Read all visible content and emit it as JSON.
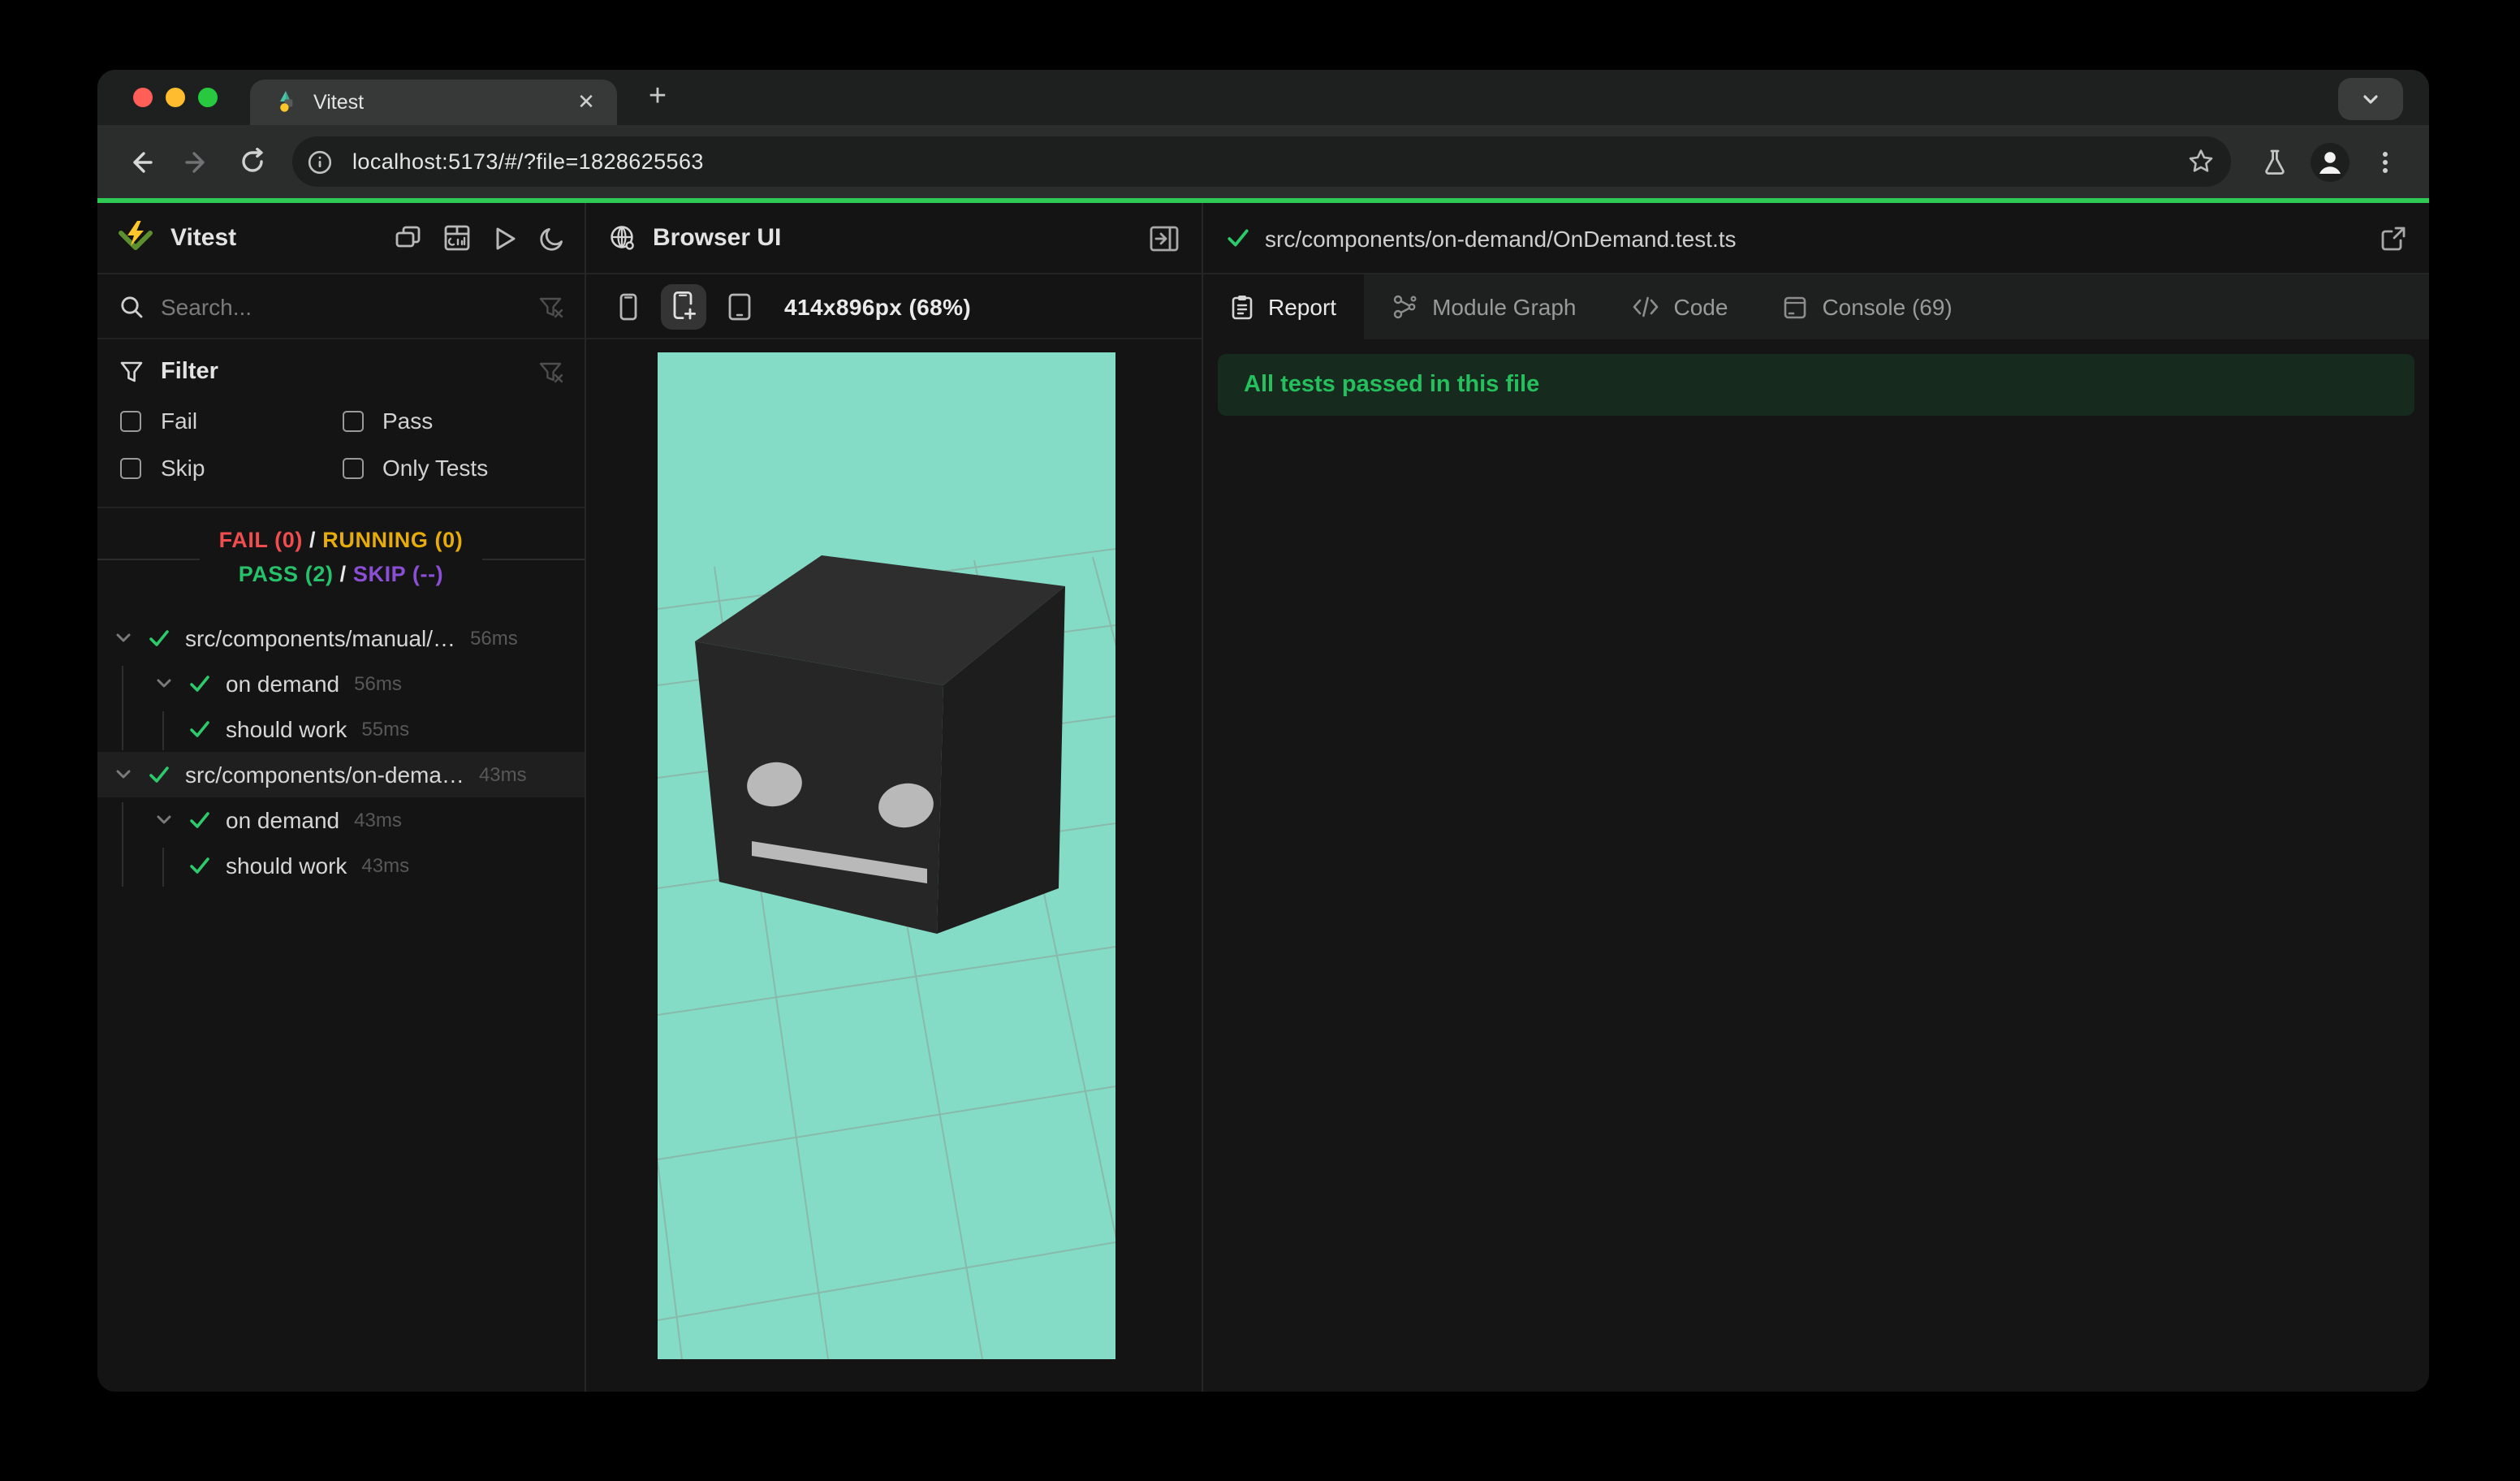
{
  "browser": {
    "tab_title": "Vitest",
    "url": "localhost:5173/#/?file=1828625563",
    "close_glyph": "✕",
    "newtab_glyph": "+"
  },
  "sidebar": {
    "app_title": "Vitest",
    "search_placeholder": "Search...",
    "filter": {
      "title": "Filter",
      "items": [
        {
          "label": "Fail"
        },
        {
          "label": "Pass"
        },
        {
          "label": "Skip"
        },
        {
          "label": "Only Tests"
        }
      ]
    },
    "summary": {
      "fail": "FAIL (0)",
      "sep1": " / ",
      "running": "RUNNING (0)",
      "pass": "PASS (2)",
      "sep2": " / ",
      "skip": "SKIP (--)"
    },
    "tree": [
      {
        "name": "src/components/manual/…",
        "duration": "56ms"
      },
      {
        "name": "on demand",
        "duration": "56ms"
      },
      {
        "name": "should work",
        "duration": "55ms"
      },
      {
        "name": "src/components/on-dema…",
        "duration": "43ms"
      },
      {
        "name": "on demand",
        "duration": "43ms"
      },
      {
        "name": "should work",
        "duration": "43ms"
      }
    ]
  },
  "preview": {
    "title": "Browser UI",
    "viewport_label": "414x896px (68%)"
  },
  "report": {
    "file_path": "src/components/on-demand/OnDemand.test.ts",
    "tabs": [
      {
        "label": "Report"
      },
      {
        "label": "Module Graph"
      },
      {
        "label": "Code"
      },
      {
        "label": "Console (69)"
      }
    ],
    "banner": "All tests passed in this file"
  },
  "scene": {
    "background": "#85dcc6",
    "grid_line": "#8aa79c",
    "cube_top": "#2e2e2e",
    "cube_front": "#262626",
    "cube_side": "#1d1d1d",
    "face_features": "#b9b9b9"
  },
  "colors": {
    "accent_green": "#2eca55",
    "pass_green": "#27c06b",
    "fail_red": "#f24d4e",
    "running_yellow": "#e7ac09",
    "skip_purple": "#8b4fd6",
    "banner_bg": "#162a1e"
  }
}
